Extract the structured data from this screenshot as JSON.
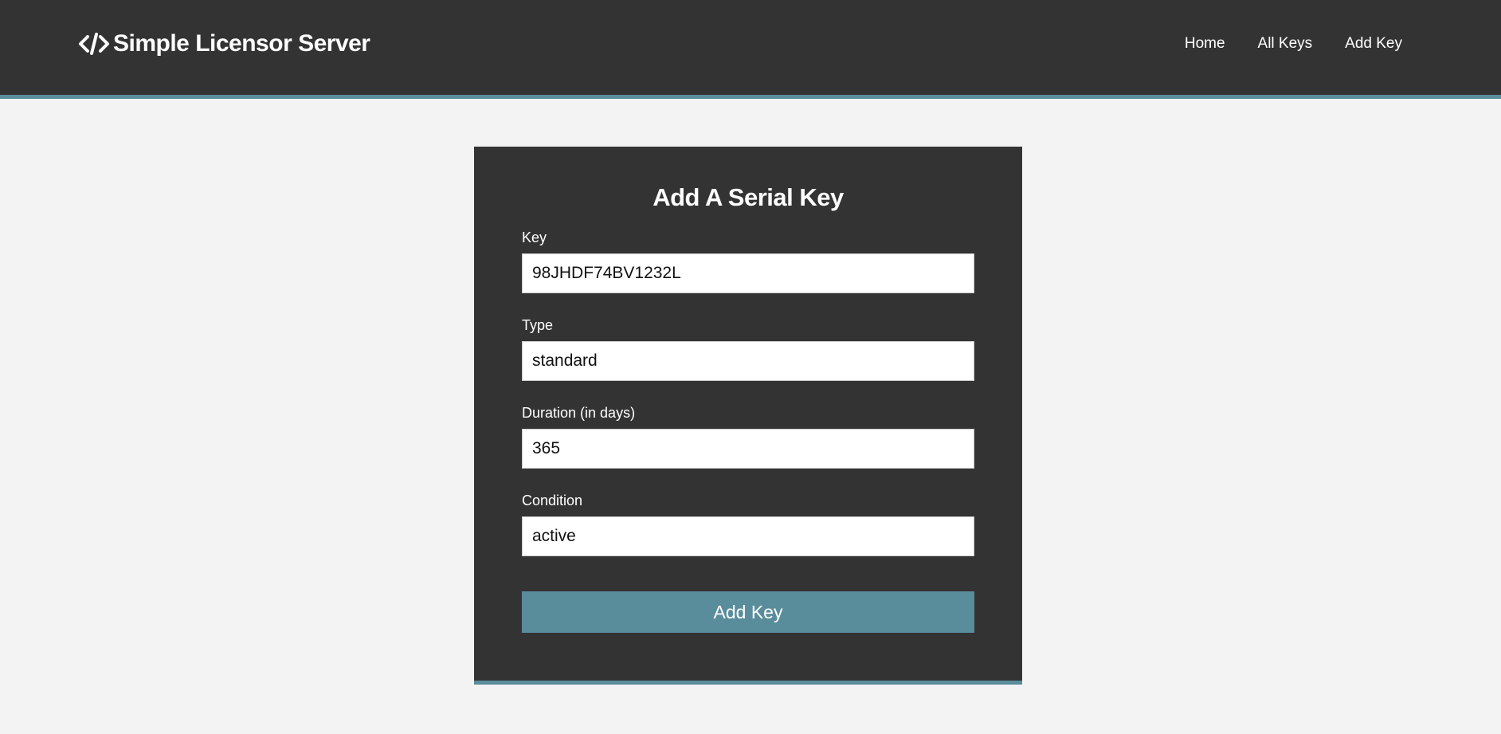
{
  "header": {
    "brand": "Simple Licensor Server",
    "brand_icon": "code-icon",
    "nav": [
      "Home",
      "All Keys",
      "Add Key"
    ]
  },
  "form": {
    "title": "Add A Serial Key",
    "fields": [
      {
        "label": "Key",
        "value": "98JHDF74BV1232L"
      },
      {
        "label": "Type",
        "value": "standard"
      },
      {
        "label": "Duration (in days)",
        "value": "365"
      },
      {
        "label": "Condition",
        "value": "active"
      }
    ],
    "submit_label": "Add Key"
  },
  "colors": {
    "dark": "#333333",
    "accent": "#5a8d9c",
    "background": "#f3f3f3"
  }
}
